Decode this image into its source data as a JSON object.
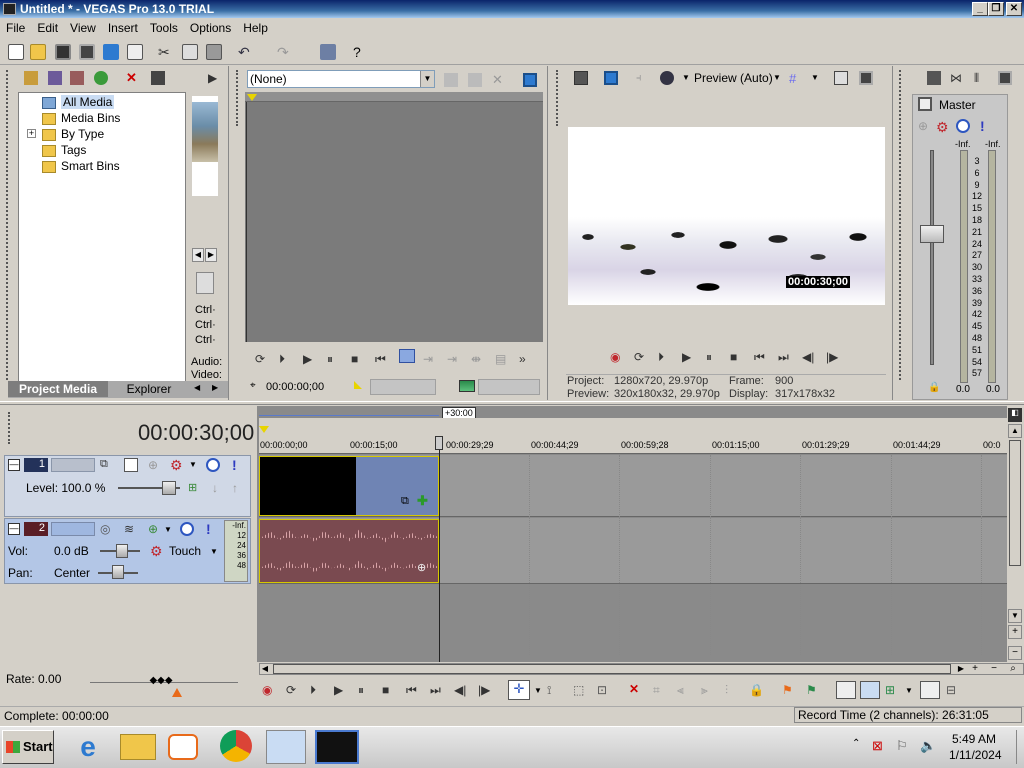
{
  "window": {
    "title": "Untitled * - VEGAS Pro 13.0 TRIAL"
  },
  "menu": [
    "File",
    "Edit",
    "View",
    "Insert",
    "Tools",
    "Options",
    "Help"
  ],
  "explorer": {
    "tree": [
      "All Media",
      "Media Bins",
      "By Type",
      "Tags",
      "Smart Bins"
    ],
    "tabs": [
      "Project Media",
      "Explorer"
    ],
    "side_labels": [
      "Ctrl·",
      "Ctrl·",
      "Ctrl·",
      "Audio:",
      "Video:"
    ]
  },
  "trimmer": {
    "dropdown": "(None)",
    "timecode": "00:00:00;00"
  },
  "preview": {
    "mode": "Preview (Auto)",
    "overlay_tc": "00:00:30;00",
    "project_label": "Project:",
    "project_value": "1280x720, 29.970p",
    "preview_label": "Preview:",
    "preview_value": "320x180x32, 29.970p",
    "frame_label": "Frame:",
    "frame_value": "900",
    "display_label": "Display:",
    "display_value": "317x178x32"
  },
  "master": {
    "title": "Master",
    "inf_left": "-Inf.",
    "inf_right": "-Inf.",
    "scale": [
      "3",
      "6",
      "9",
      "12",
      "15",
      "18",
      "21",
      "24",
      "27",
      "30",
      "33",
      "36",
      "39",
      "42",
      "45",
      "48",
      "51",
      "54",
      "57"
    ],
    "value_left": "0.0",
    "value_right": "0.0"
  },
  "timeline": {
    "timecode": "00:00:30;00",
    "loop_marker": "+30:00",
    "ruler": [
      "00:00:00;00",
      "00:00:15;00",
      "00:00:29;29",
      "00:00:44;29",
      "00:00:59;28",
      "00:01:15;00",
      "00:01:29;29",
      "00:01:44;29",
      "00:0"
    ],
    "track1": {
      "number": "1",
      "level_label": "Level: 100.0 %"
    },
    "track2": {
      "number": "2",
      "vol_label": "Vol:",
      "vol_value": "0.0 dB",
      "touch": "Touch",
      "pan_label": "Pan:",
      "pan_value": "Center",
      "meter": [
        "-Inf.",
        "12",
        "24",
        "36",
        "48"
      ]
    },
    "rate": "Rate: 0.00"
  },
  "status": {
    "complete": "Complete: 00:00:00",
    "record_time": "Record Time (2 channels): 26:31:05"
  },
  "taskbar": {
    "start": "Start",
    "time": "5:49 AM",
    "date": "1/11/2024"
  },
  "colors": {
    "titlebar": "#0a246a",
    "video_track": "#6f84b4",
    "audio_track": "#7a4a50",
    "track_header_selected": "#b3c6e6"
  }
}
